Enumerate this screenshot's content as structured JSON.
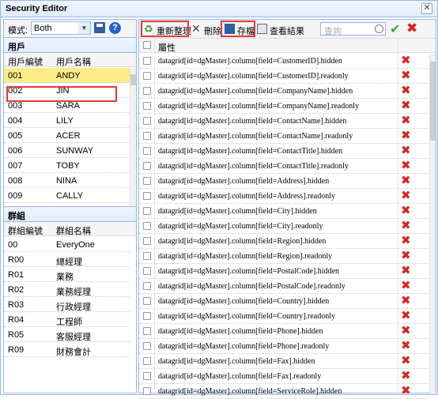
{
  "window": {
    "title": "Security Editor",
    "close_label": "✕"
  },
  "left": {
    "mode_label": "模式:",
    "mode_value": "Both",
    "users": {
      "section_title": "用戶",
      "columns": [
        "用戶編號",
        "用戶名稱"
      ],
      "rows": [
        [
          "001",
          "ANDY"
        ],
        [
          "002",
          "JIN"
        ],
        [
          "003",
          "SARA"
        ],
        [
          "004",
          "LILY"
        ],
        [
          "005",
          "ACER"
        ],
        [
          "006",
          "SUNWAY"
        ],
        [
          "007",
          "TOBY"
        ],
        [
          "008",
          "NINA"
        ],
        [
          "009",
          "CALLY"
        ]
      ]
    },
    "groups": {
      "section_title": "群組",
      "columns": [
        "群組編號",
        "群組名稱"
      ],
      "rows": [
        [
          "00",
          "EveryOne"
        ],
        [
          "R00",
          "總經理"
        ],
        [
          "R01",
          "業務"
        ],
        [
          "R02",
          "業務經理"
        ],
        [
          "R03",
          "行政經理"
        ],
        [
          "R04",
          "工程師"
        ],
        [
          "R05",
          "客服經理"
        ],
        [
          "R09",
          "財務會計"
        ]
      ]
    }
  },
  "right": {
    "toolbar": {
      "refresh_label": "重新整理",
      "delete_label": "刪除",
      "save_label": "存檔",
      "view_label": "查看結果",
      "search_placeholder": "查詢"
    },
    "column_header": "屬性",
    "rows": [
      "datagrid[id=dgMaster].column[field=CustomerID].hidden",
      "datagrid[id=dgMaster].column[field=CustomerID].readonly",
      "datagrid[id=dgMaster].column[field=CompanyName].hidden",
      "datagrid[id=dgMaster].column[field=CompanyName].readonly",
      "datagrid[id=dgMaster].column[field=ContactName].hidden",
      "datagrid[id=dgMaster].column[field=ContactName].readonly",
      "datagrid[id=dgMaster].column[field=ContactTitle].hidden",
      "datagrid[id=dgMaster].column[field=ContactTitle].readonly",
      "datagrid[id=dgMaster].column[field=Address].hidden",
      "datagrid[id=dgMaster].column[field=Address].readonly",
      "datagrid[id=dgMaster].column[field=City].hidden",
      "datagrid[id=dgMaster].column[field=City].readonly",
      "datagrid[id=dgMaster].column[field=Region].hidden",
      "datagrid[id=dgMaster].column[field=Region].readonly",
      "datagrid[id=dgMaster].column[field=PostalCode].hidden",
      "datagrid[id=dgMaster].column[field=PostalCode].readonly",
      "datagrid[id=dgMaster].column[field=Country].hidden",
      "datagrid[id=dgMaster].column[field=Country].readonly",
      "datagrid[id=dgMaster].column[field=Phone].hidden",
      "datagrid[id=dgMaster].column[field=Phone].readonly",
      "datagrid[id=dgMaster].column[field=Fax].hidden",
      "datagrid[id=dgMaster].column[field=Fax].readonly",
      "datagrid[id=dgMaster].column[field=ServiceRole].hidden"
    ]
  }
}
